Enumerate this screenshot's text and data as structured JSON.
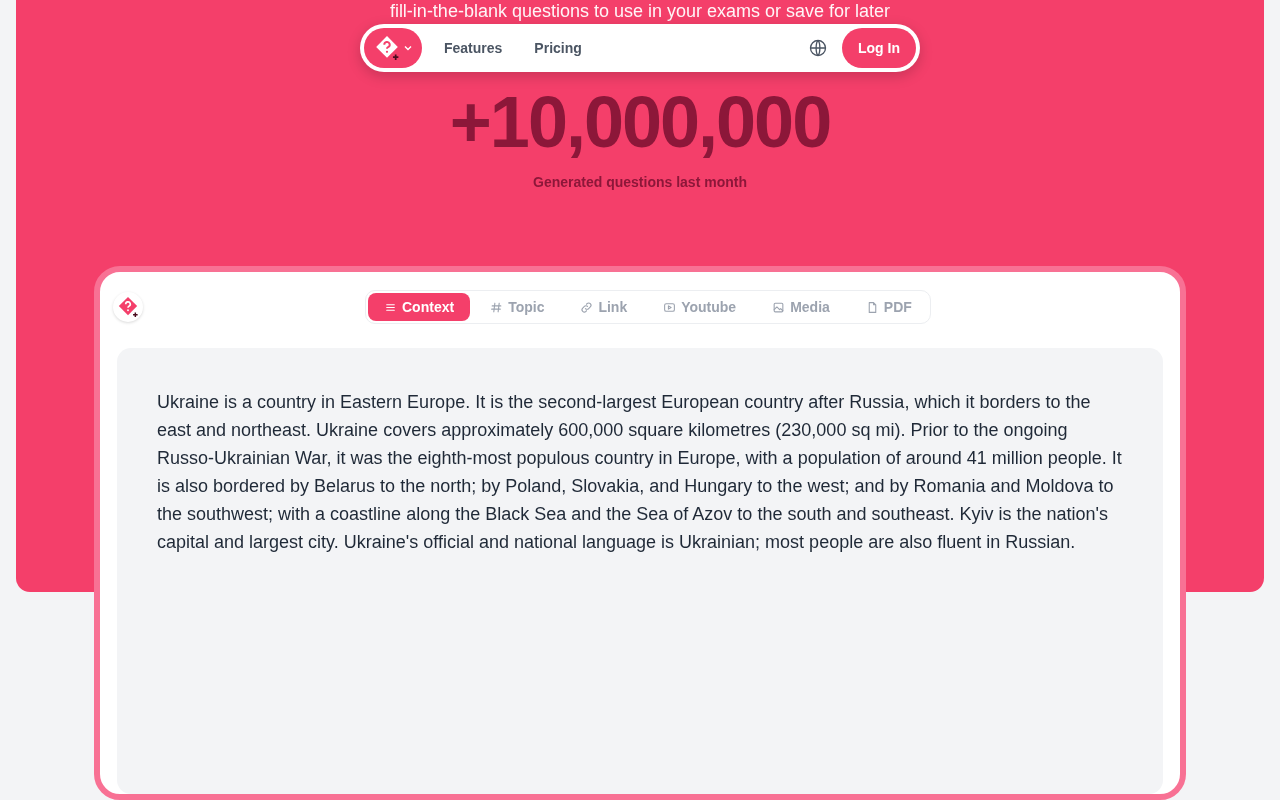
{
  "hero": {
    "subtitle_fragment": "fill-in-the-blank questions to use in your exams or save for later",
    "stat_value": "+10,000,000",
    "stat_label": "Generated questions last month"
  },
  "nav": {
    "links": [
      {
        "label": "Features"
      },
      {
        "label": "Pricing"
      }
    ],
    "login": "Log In"
  },
  "tabs": [
    {
      "label": "Context",
      "kind": "lines",
      "selected": true
    },
    {
      "label": "Topic",
      "kind": "hash",
      "selected": false
    },
    {
      "label": "Link",
      "kind": "link",
      "selected": false
    },
    {
      "label": "Youtube",
      "kind": "play",
      "selected": false
    },
    {
      "label": "Media",
      "kind": "image",
      "selected": false
    },
    {
      "label": "PDF",
      "kind": "file",
      "selected": false
    }
  ],
  "input": {
    "value": "Ukraine is a country in Eastern Europe. It is the second-largest European country after Russia, which it borders to the east and northeast. Ukraine covers approximately 600,000 square kilometres (230,000 sq mi). Prior to the ongoing Russo-Ukrainian War, it was the eighth-most populous country in Europe, with a population of around 41 million people. It is also bordered by Belarus to the north; by Poland, Slovakia, and Hungary to the west; and by Romania and Moldova to the southwest; with a coastline along the Black Sea and the Sea of Azov to the south and southeast. Kyiv is the nation's capital and largest city. Ukraine's official and national language is Ukrainian; most people are also fluent in Russian."
  }
}
